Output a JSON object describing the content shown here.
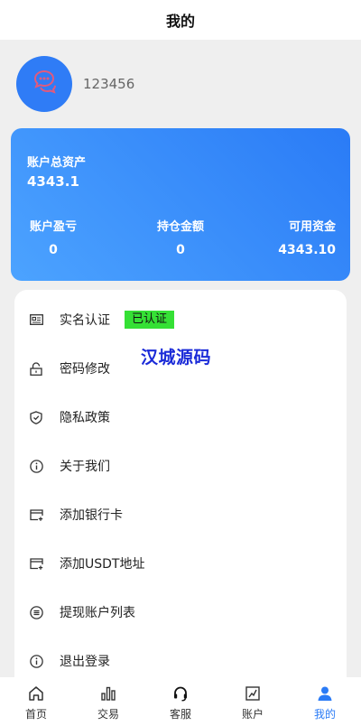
{
  "header": {
    "title": "我的"
  },
  "profile": {
    "username": "123456",
    "avatar_icon": "chat-bubbles-icon"
  },
  "assets": {
    "total_label": "账户总资产",
    "total_value": "4343.1",
    "stats": [
      {
        "label": "账户盈亏",
        "value": "0"
      },
      {
        "label": "持仓金额",
        "value": "0"
      },
      {
        "label": "可用资金",
        "value": "4343.10"
      }
    ]
  },
  "menu": {
    "items": [
      {
        "label": "实名认证",
        "icon": "id-card-icon",
        "badge": "已认证"
      },
      {
        "label": "密码修改",
        "icon": "lock-icon"
      },
      {
        "label": "隐私政策",
        "icon": "shield-icon"
      },
      {
        "label": "关于我们",
        "icon": "info-icon"
      },
      {
        "label": "添加银行卡",
        "icon": "card-add-icon"
      },
      {
        "label": "添加USDT地址",
        "icon": "card-add-icon"
      },
      {
        "label": "提现账户列表",
        "icon": "list-icon"
      },
      {
        "label": "退出登录",
        "icon": "info-icon"
      }
    ]
  },
  "watermark": "汉城源码",
  "tabbar": {
    "tabs": [
      {
        "label": "首页",
        "icon": "home-icon"
      },
      {
        "label": "交易",
        "icon": "chart-icon"
      },
      {
        "label": "客服",
        "icon": "headset-icon"
      },
      {
        "label": "账户",
        "icon": "account-icon"
      },
      {
        "label": "我的",
        "icon": "user-icon",
        "active": true
      }
    ]
  },
  "colors": {
    "accent": "#2a7bf6",
    "badge": "#35e035",
    "watermark": "#1b2bd8"
  }
}
